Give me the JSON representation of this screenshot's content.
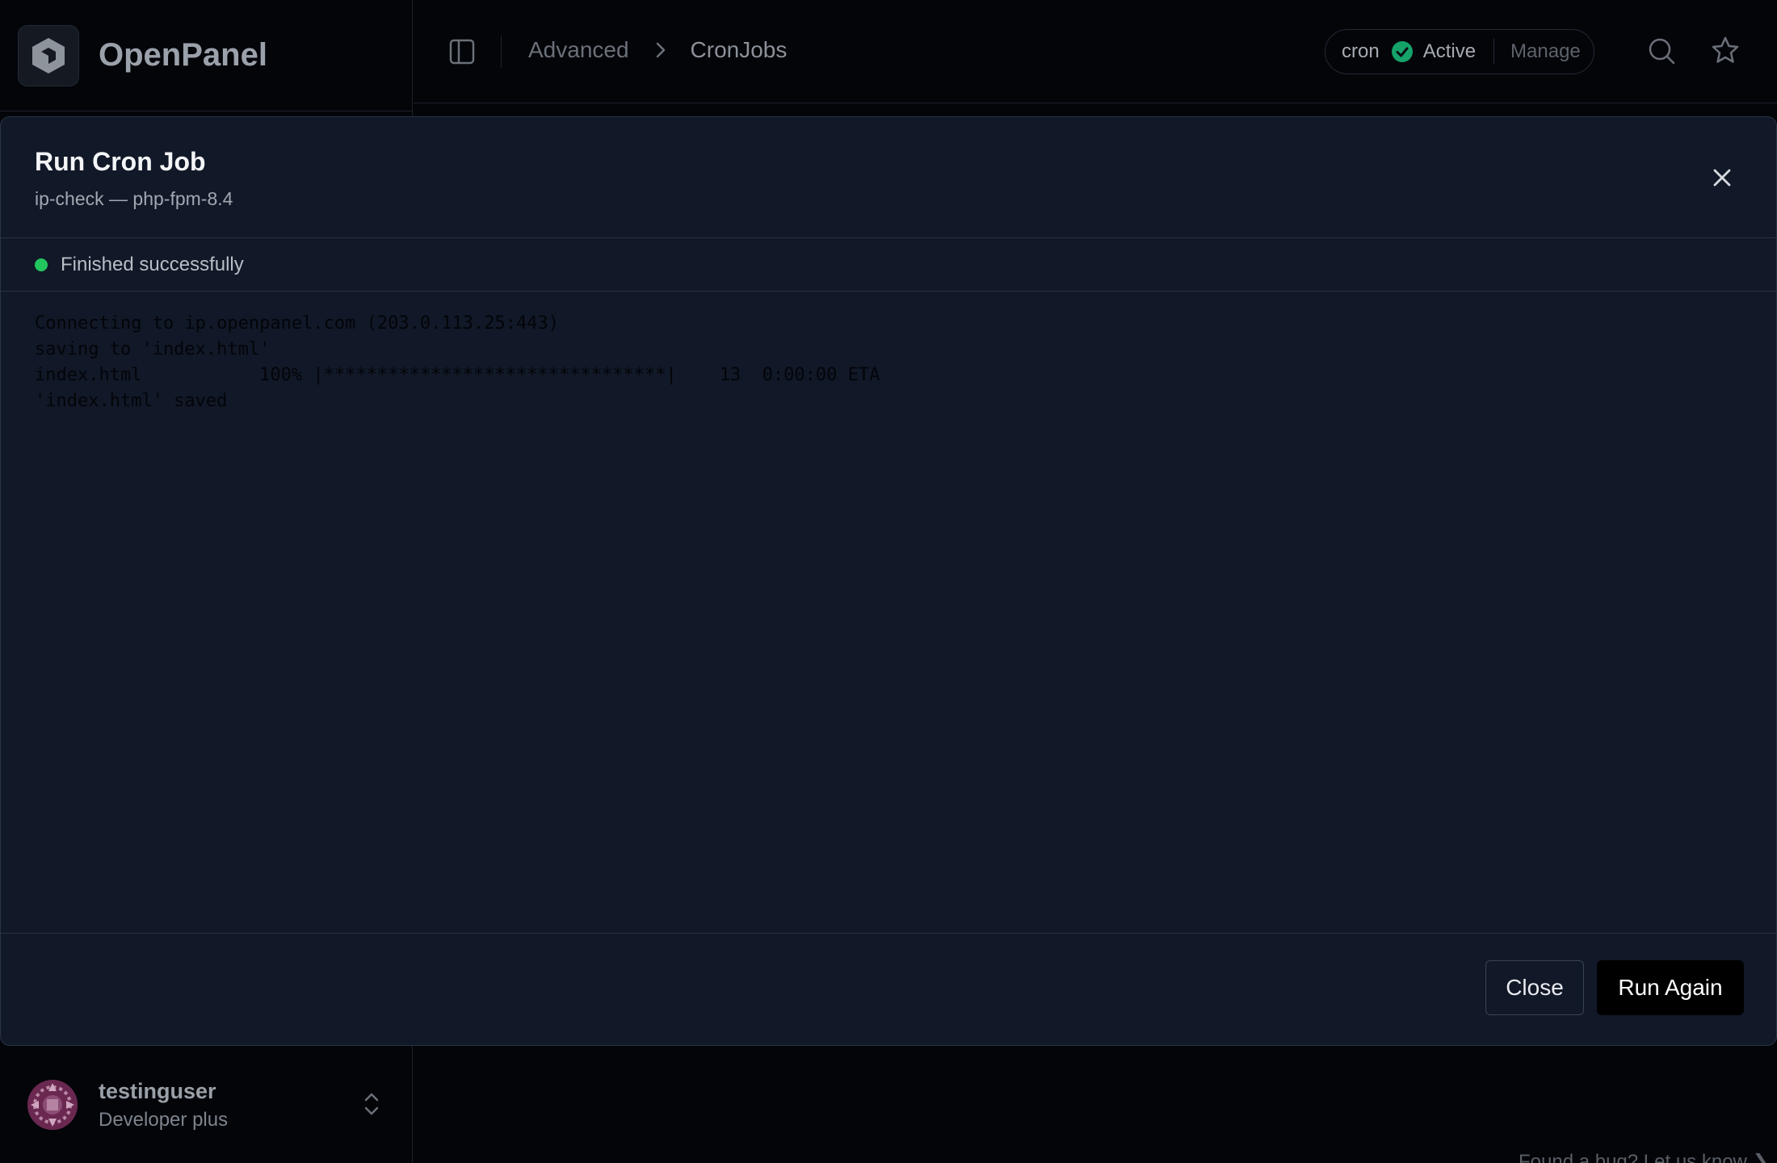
{
  "brand": {
    "name": "OpenPanel",
    "logo_icon": "openpanel-logo-icon"
  },
  "user": {
    "name": "testinguser",
    "plan": "Developer plus"
  },
  "topbar": {
    "breadcrumb": [
      "Advanced",
      "CronJobs"
    ],
    "status": {
      "service": "cron",
      "state": "Active",
      "action": "Manage",
      "state_color": "#15a36a"
    }
  },
  "footer_hint": "Found a bug? Let us know ❯",
  "modal": {
    "title": "Run Cron Job",
    "subtitle": "ip-check — php-fpm-8.4",
    "status_text": "Finished successfully",
    "status_color": "#22c55e",
    "log_lines": [
      "Connecting to ip.openpanel.com (203.0.113.25:443)",
      "saving to 'index.html'",
      "index.html           100% |********************************|    13  0:00:00 ETA",
      "'index.html' saved"
    ],
    "buttons": {
      "close": "Close",
      "run_again": "Run Again"
    }
  }
}
